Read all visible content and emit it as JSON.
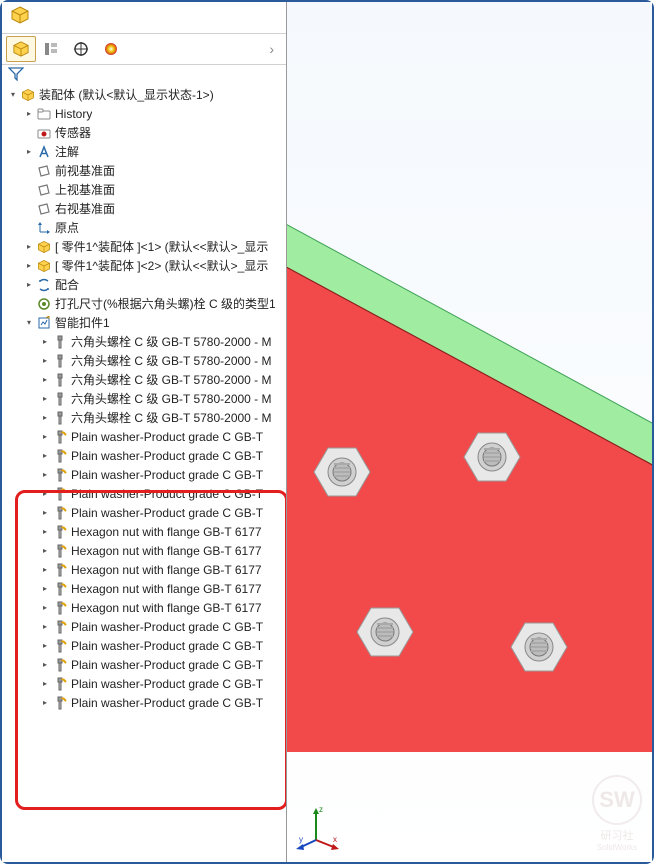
{
  "assembly": {
    "root_label": "装配体 (默认<默认_显示状态-1>)"
  },
  "tree": {
    "history": "History",
    "sensors": "传感器",
    "annotations": "注解",
    "front_plane": "前视基准面",
    "top_plane": "上视基准面",
    "right_plane": "右视基准面",
    "origin": "原点",
    "part1": "[ 零件1^装配体 ]<1> (默认<<默认>_显示",
    "part2": "[ 零件1^装配体 ]<2> (默认<<默认>_显示",
    "mates": "配合",
    "hole_series": "打孔尺寸(%根据六角头螺)栓 C 级的类型1",
    "smart_fasteners": "智能扣件1",
    "bolt": "六角头螺栓 C 级 GB-T 5780-2000 - M",
    "washer": "Plain washer-Product grade C GB-T",
    "nut": "Hexagon nut with flange GB-T 6177"
  },
  "counts": {
    "bolts": 5,
    "highlighted_order": [
      "washer",
      "washer",
      "washer",
      "washer",
      "washer",
      "nut",
      "nut",
      "nut",
      "nut",
      "nut",
      "washer",
      "washer",
      "washer",
      "washer",
      "washer"
    ]
  },
  "watermark": {
    "sw": "SW",
    "club": "研习社",
    "site": "SolidWorks"
  }
}
